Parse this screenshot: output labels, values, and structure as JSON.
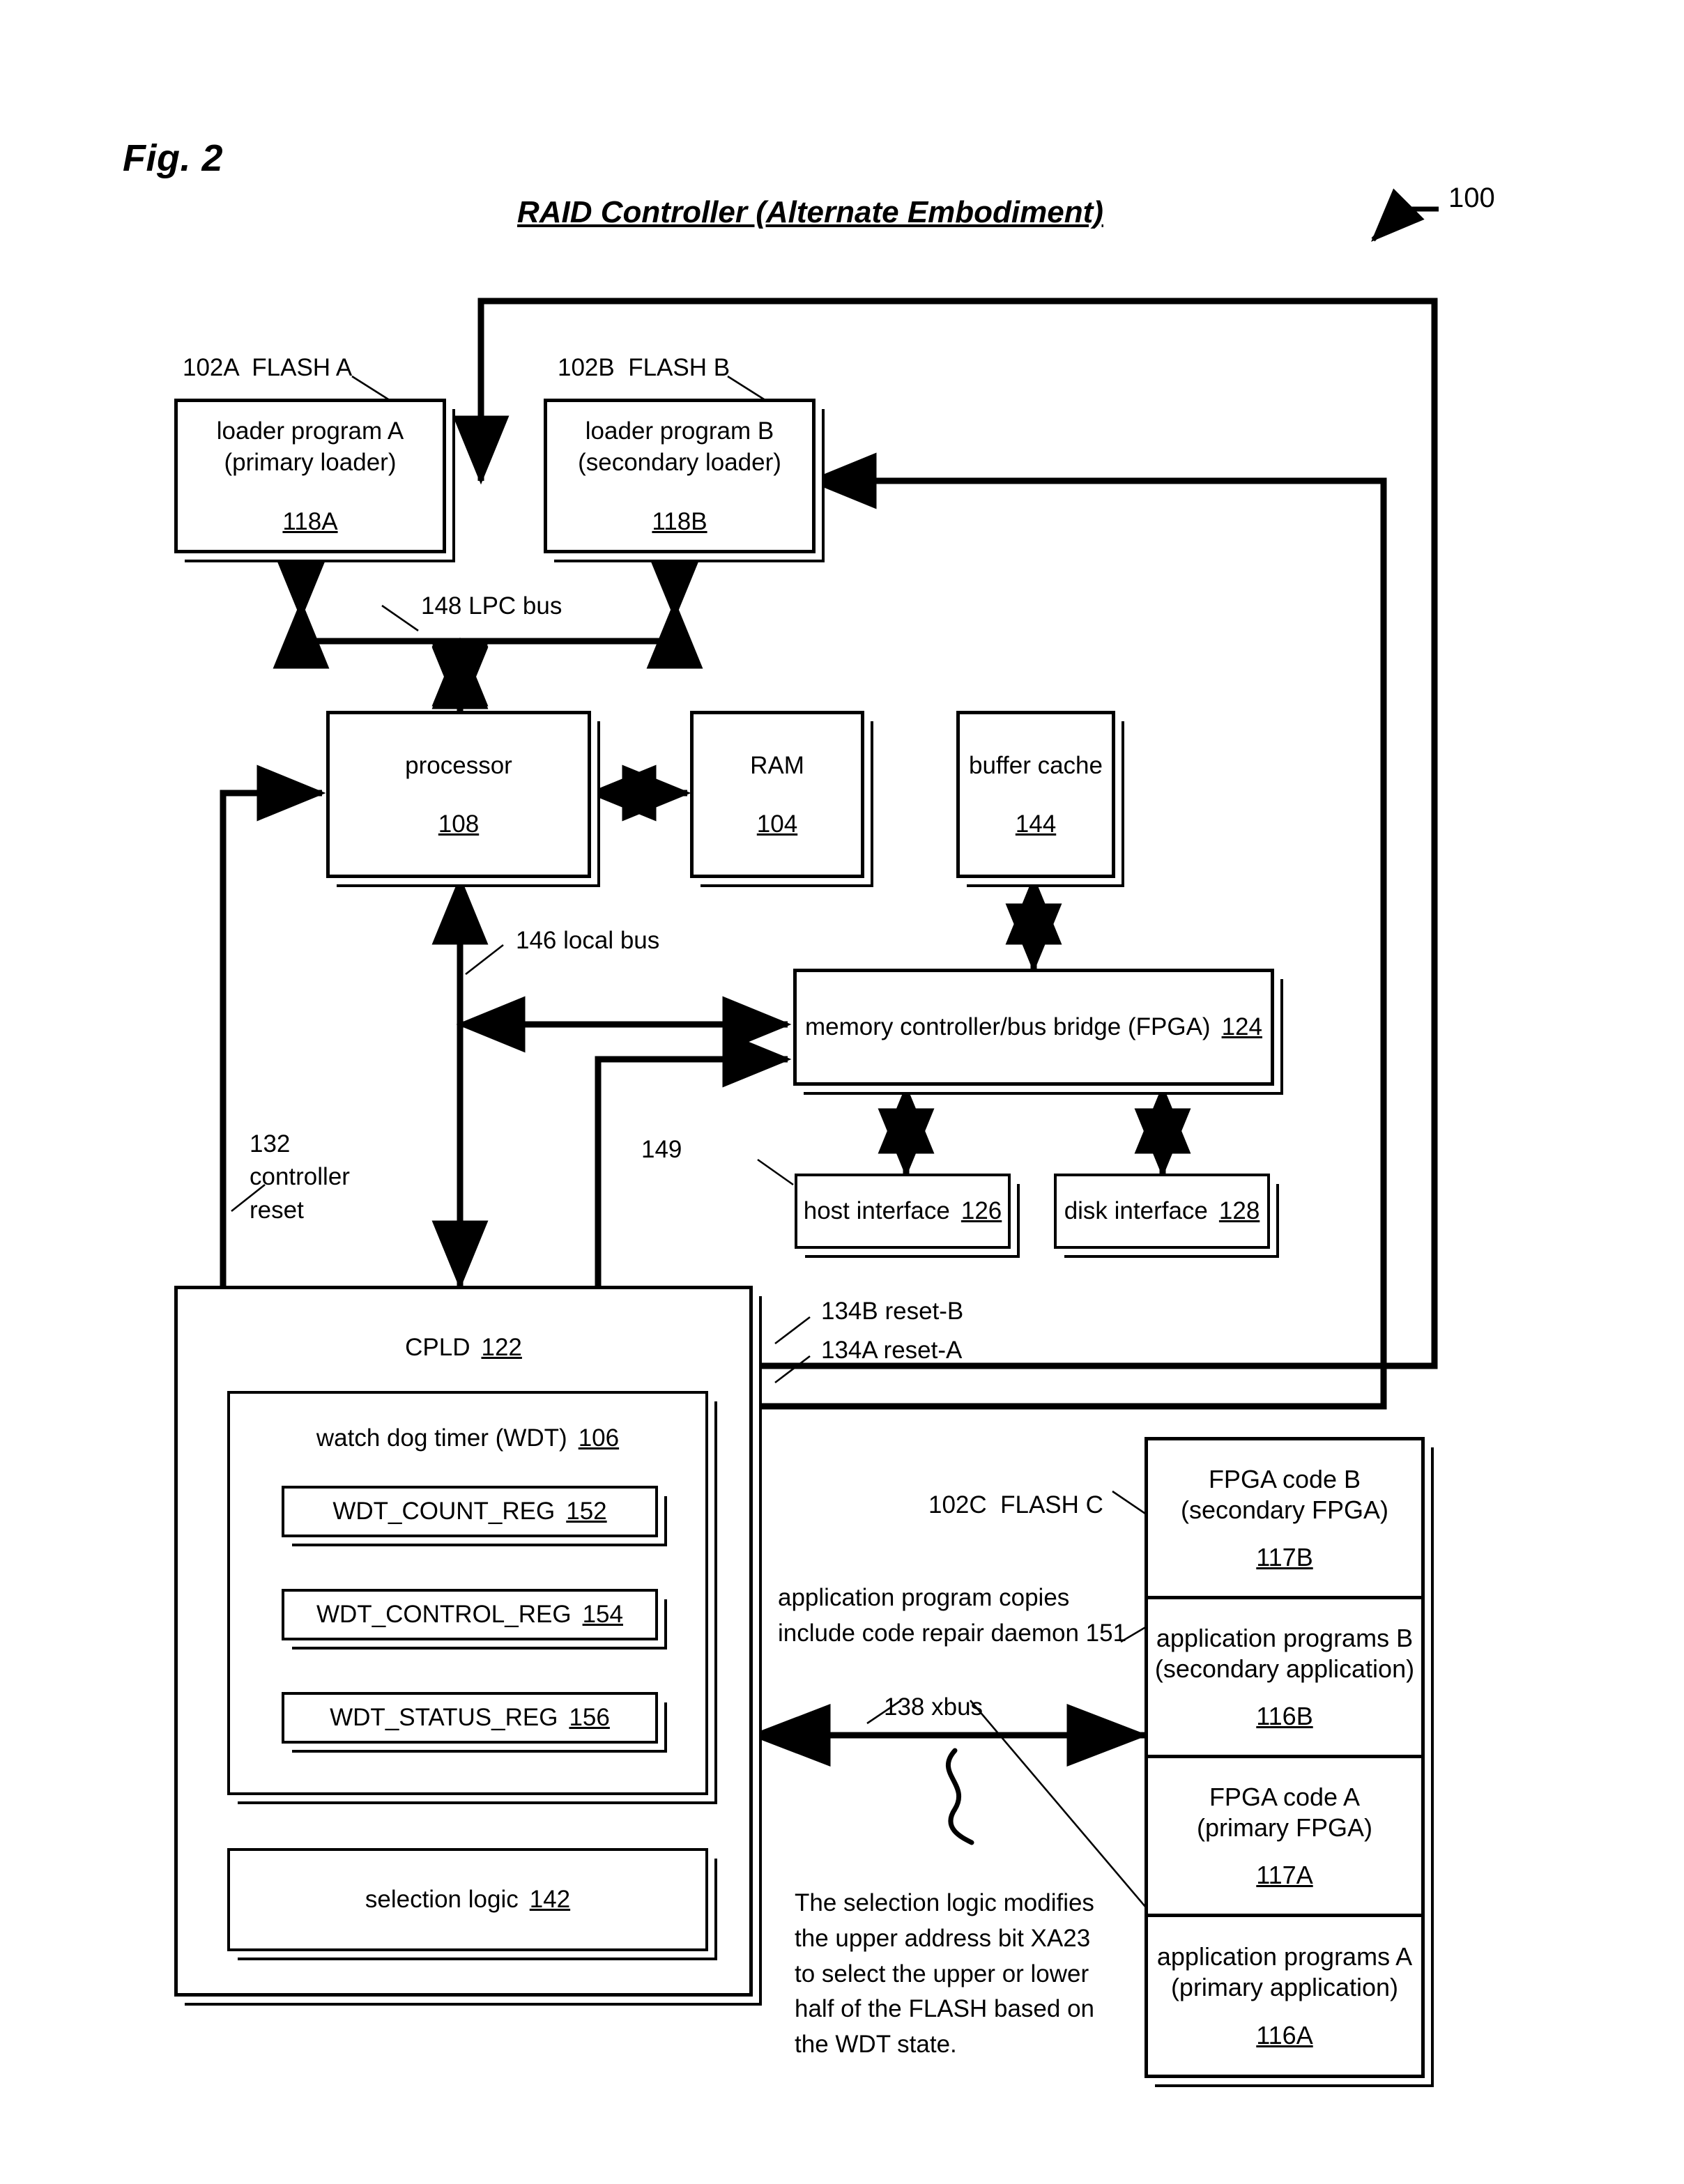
{
  "figure": {
    "label": "Fig. 2",
    "title": "RAID Controller (Alternate Embodiment)",
    "ref": "100"
  },
  "flash_a": {
    "tag": "102A  FLASH A",
    "line1": "loader program A\n(primary loader)",
    "num": "118A"
  },
  "flash_b": {
    "tag": "102B  FLASH B",
    "line1": "loader program B\n(secondary loader)",
    "num": "118B"
  },
  "buses": {
    "lpc": "148 LPC bus",
    "local": "146 local bus",
    "xbus": "138 xbus",
    "line_149": "149"
  },
  "processor": {
    "title": "processor",
    "num": "108"
  },
  "ram": {
    "title": "RAM",
    "num": "104"
  },
  "buffer_cache": {
    "title": "buffer cache",
    "num": "144"
  },
  "memory_controller": {
    "title": "memory controller/bus bridge (FPGA)",
    "num": "124"
  },
  "host_interface": {
    "title": "host interface",
    "num": "126"
  },
  "disk_interface": {
    "title": "disk interface",
    "num": "128"
  },
  "controller_reset": {
    "label": "132\ncontroller\nreset"
  },
  "reset_b": "134B reset-B",
  "reset_a": "134A reset-A",
  "cpld": {
    "title": "CPLD",
    "num": "122"
  },
  "wdt": {
    "title": "watch dog timer (WDT)",
    "num": "106",
    "registers": [
      {
        "name": "WDT_COUNT_REG",
        "num": "152"
      },
      {
        "name": "WDT_CONTROL_REG",
        "num": "154"
      },
      {
        "name": "WDT_STATUS_REG",
        "num": "156"
      }
    ]
  },
  "selection_logic": {
    "title": "selection logic",
    "num": "142"
  },
  "flash_c": {
    "tag": "102C  FLASH C",
    "cells": [
      {
        "title": "FPGA code B\n(secondary FPGA)",
        "num": "117B"
      },
      {
        "title": "application programs B\n(secondary application)",
        "num": "116B"
      },
      {
        "title": "FPGA code A\n(primary FPGA)",
        "num": "117A"
      },
      {
        "title": "application programs A\n(primary application)",
        "num": "116A"
      }
    ]
  },
  "notes": {
    "daemon": "application program copies\ninclude code repair daemon 151",
    "selection": "The selection logic modifies\nthe upper address bit XA23\nto select the upper or lower\nhalf of the FLASH based on\nthe WDT state."
  }
}
